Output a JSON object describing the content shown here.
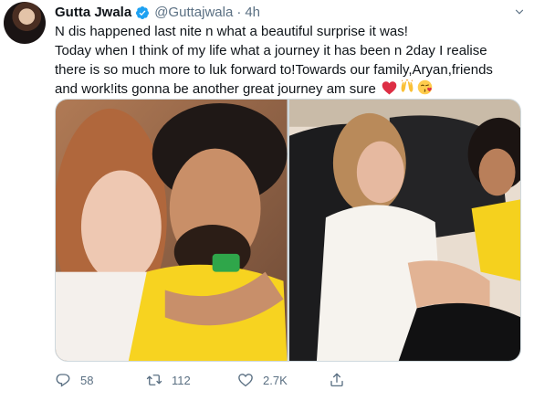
{
  "author": {
    "display_name": "Gutta Jwala",
    "handle": "@Guttajwala",
    "separator": "·",
    "time": "4h",
    "verified_icon": "verified-badge-icon",
    "verified_color": "#1da1f2"
  },
  "tweet": {
    "lines": [
      "N dis happened last nite n what a beautiful surprise it was!",
      "Today when I think of my life what a journey it has been n 2day I realise",
      "there is so much more to luk forward to!Towards our family,Aryan,friends",
      "and work!its gonna be another great journey am sure"
    ],
    "emojis": [
      "red-heart-icon",
      "raising-hands-icon",
      "face-blowing-kiss-icon"
    ]
  },
  "media": {
    "photos": [
      {
        "description_icon": "selfie-photo"
      },
      {
        "description_icon": "sofa-photo"
      }
    ]
  },
  "actions": {
    "reply_count": "58",
    "retweet_count": "112",
    "like_count": "2.7K",
    "icons": [
      "reply-icon",
      "retweet-icon",
      "like-icon",
      "share-icon"
    ]
  },
  "colors": {
    "text": "#0f1419",
    "secondary": "#5b7083",
    "accent": "#1da1f2"
  }
}
